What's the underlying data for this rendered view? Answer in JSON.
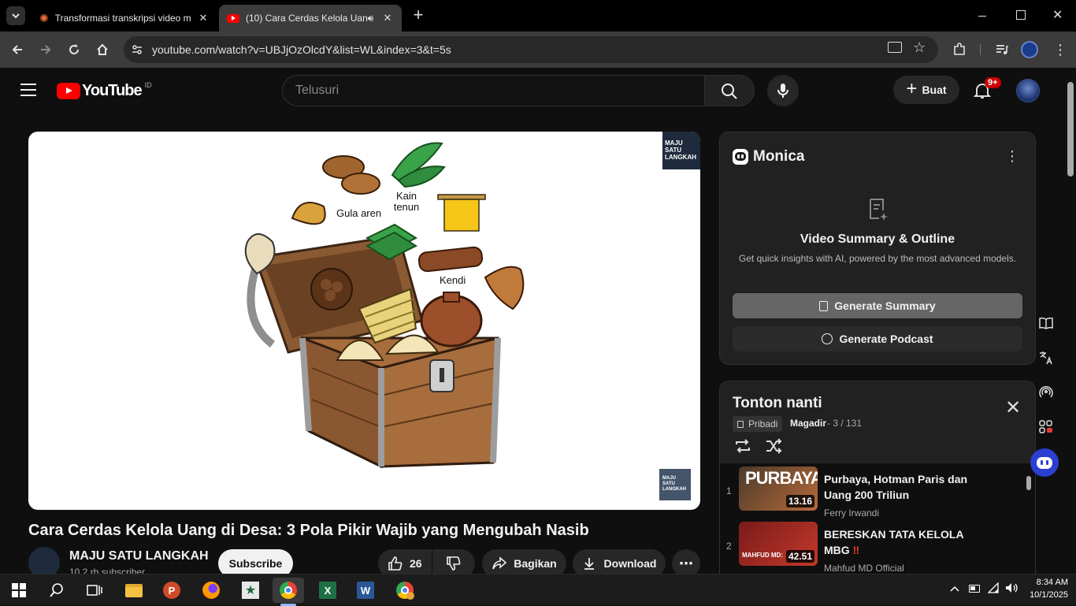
{
  "browser": {
    "tabs": [
      {
        "title": "Transformasi transkripsi video m",
        "active": false
      },
      {
        "title": "(10) Cara Cerdas Kelola Uan",
        "active": true,
        "audio": true
      }
    ],
    "new_tab": "+",
    "url": "youtube.com/watch?v=UBJjOzOlcdY&list=WL&index=3&t=5s"
  },
  "youtube": {
    "logo_text": "YouTube",
    "country": "ID",
    "search_placeholder": "Telusuri",
    "create_label": "Buat",
    "notif_count": "9+",
    "video": {
      "title": "Cara Cerdas Kelola Uang di Desa: 3 Pola Pikir Wajib yang Mengubah Nasib",
      "channel": "MAJU SATU LANGKAH",
      "subscribers": "10,2 rb subscriber",
      "subscribe_label": "Subscribe",
      "likes": "26",
      "share_label": "Bagikan",
      "download_label": "Download",
      "illustration_labels": {
        "gula": "Gula aren",
        "kain": "Kain tenun",
        "kendi": "Kendi"
      },
      "watermark": "MAJU SATU LANGKAH"
    },
    "monica": {
      "name": "Monica",
      "heading": "Video Summary & Outline",
      "subtitle": "Get quick insights with AI, powered by the most advanced models.",
      "summary_btn": "Generate Summary",
      "podcast_btn": "Generate Podcast"
    },
    "playlist": {
      "title": "Tonton nanti",
      "privacy": "Pribadi",
      "owner": "Magadir",
      "position": "- 3 / 131",
      "items": [
        {
          "index": "1",
          "title": "Purbaya, Hotman Paris dan Uang 200 Triliun",
          "channel": "Ferry Irwandi",
          "duration": "13.16",
          "thumb_text": "PURBAYA"
        },
        {
          "index": "2",
          "title": "BERESKAN TATA KELOLA MBG",
          "title_mark": "‼",
          "channel": "Mahfud MD Official",
          "duration": "42.51",
          "thumb_text": "MAHFUD MD:"
        }
      ]
    }
  },
  "taskbar": {
    "time": "8:34 AM",
    "date": "10/1/2025"
  },
  "colors": {
    "yt_red": "#ff0000",
    "monica_btn": "#666666",
    "bg": "#0f0f0f"
  }
}
